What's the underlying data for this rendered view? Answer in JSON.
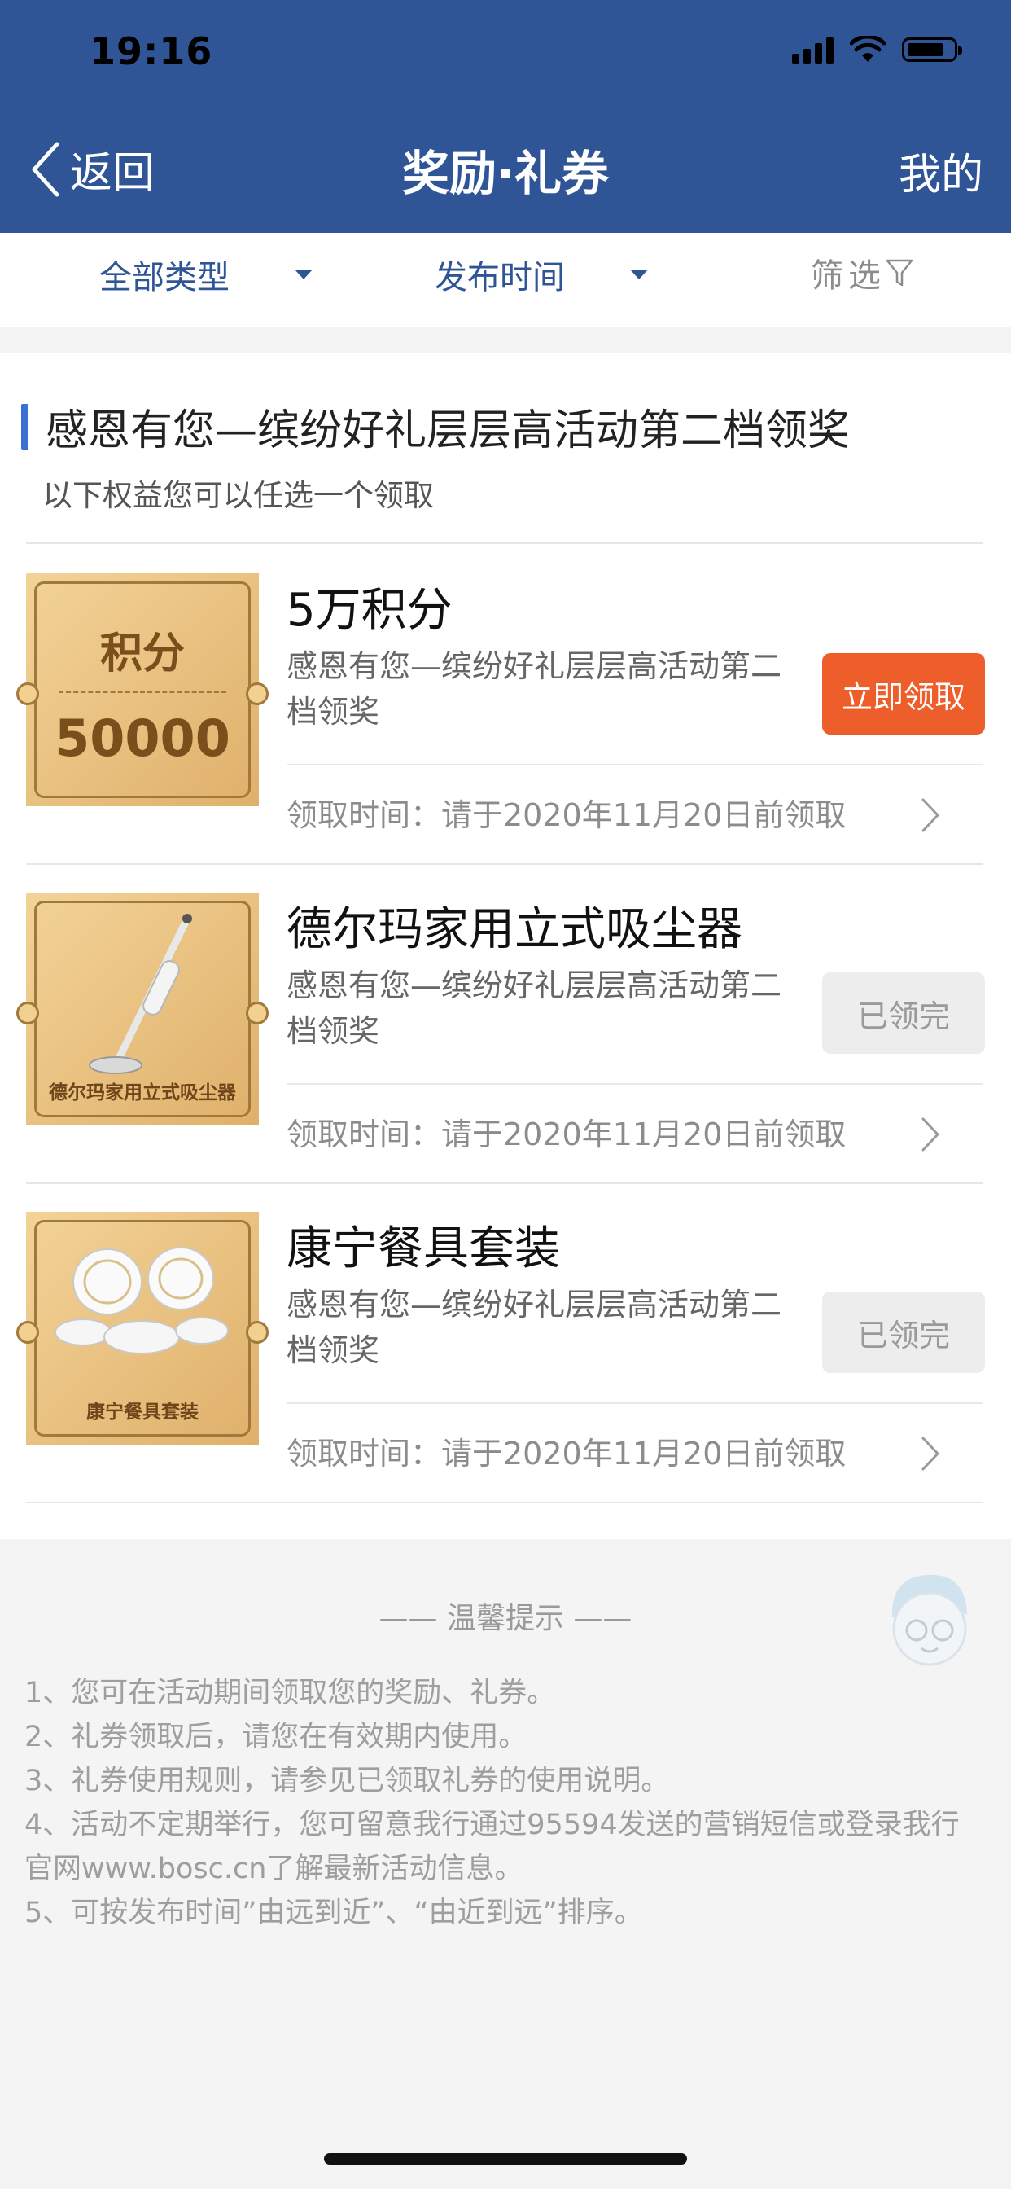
{
  "status_bar": {
    "time": "19:16"
  },
  "nav": {
    "back_label": "返回",
    "title": "奖励·礼券",
    "mine_label": "我的"
  },
  "filters": {
    "type_label": "全部类型",
    "time_label": "发布时间",
    "screen_label": "筛选"
  },
  "section": {
    "title": "感恩有您—缤纷好礼层层高活动第二档领奖",
    "subtitle": "以下权益您可以任选一个领取"
  },
  "items": [
    {
      "image_text": {
        "top": "积分",
        "bottom": "50000"
      },
      "title": "5万积分",
      "desc": "感恩有您—缤纷好礼层层高活动第二档领奖",
      "button": "立即领取",
      "time": "领取时间：请于2020年11月20日前领取"
    },
    {
      "image_text": {
        "label": "德尔玛家用立式吸尘器"
      },
      "title": "德尔玛家用立式吸尘器",
      "desc": "感恩有您—缤纷好礼层层高活动第二档领奖",
      "button": "已领完",
      "time": "领取时间：请于2020年11月20日前领取"
    },
    {
      "image_text": {
        "label": "康宁餐具套装"
      },
      "title": "康宁餐具套装",
      "desc": "感恩有您—缤纷好礼层层高活动第二档领奖",
      "button": "已领完",
      "time": "领取时间：请于2020年11月20日前领取"
    }
  ],
  "tips": {
    "heading": "—— 温馨提示 ——",
    "lines": [
      "1、您可在活动期间领取您的奖励、礼券。",
      "2、礼券领取后，请您在有效期内使用。",
      "3、礼券使用规则，请参见已领取礼券的使用说明。",
      "4、活动不定期举行，您可留意我行通过95594发送的营销短信或登录我行官网www.bosc.cn了解最新活动信息。",
      "5、可按发布时间”由远到近”、“由近到远”排序。"
    ]
  },
  "colors": {
    "nav": "#2f5597",
    "accent_button": "#ee5e2a",
    "section_bar": "#3a6fd4"
  }
}
